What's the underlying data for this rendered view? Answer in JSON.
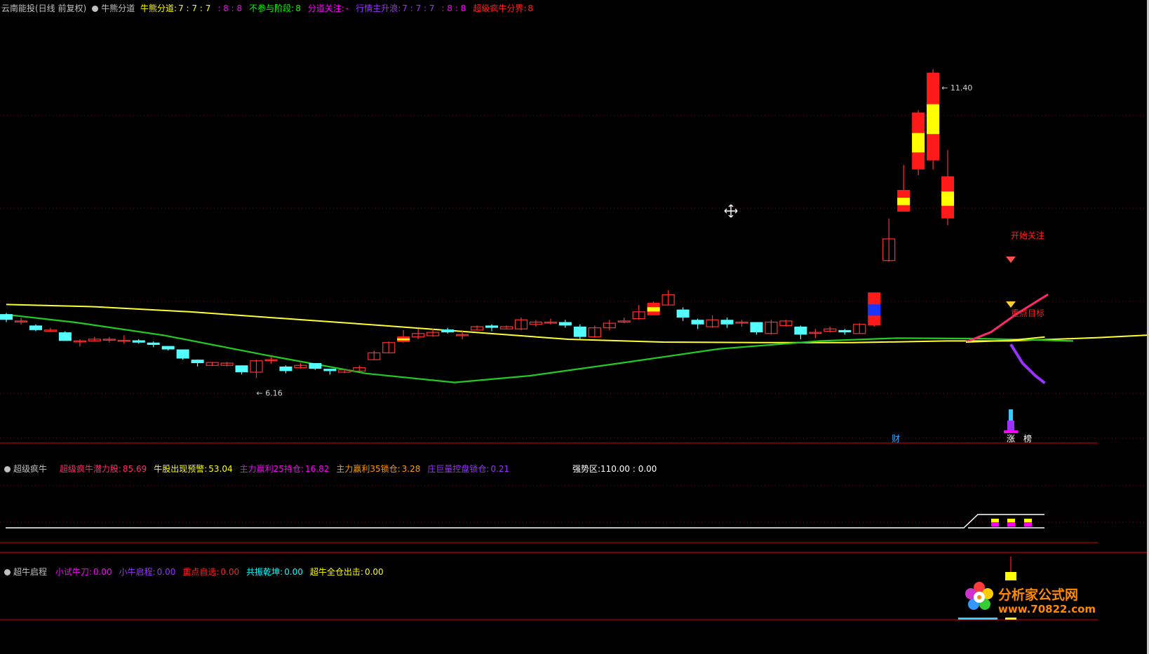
{
  "main_header": {
    "stock": "云南能投(日线 前复权)",
    "indicator": "牛熊分道",
    "items": [
      {
        "label": "牛熊分道:",
        "value": "7 : 7 : 7",
        "extra": ": 8 : 8",
        "color": "#ffff00",
        "vcolor": "#ffff00",
        "xcolor": "#ff00ff"
      },
      {
        "label": "不参与阶段:",
        "value": "8",
        "color": "#00ff00",
        "vcolor": "#00ff00"
      },
      {
        "label": "分道关注:",
        "value": "-",
        "color": "#ff00ff",
        "vcolor": "#ff00ff"
      },
      {
        "label": "行情主升浪:",
        "value": "7 : 7 : 7",
        "extra": ": 8 : 8",
        "color": "#9933ff",
        "vcolor": "#9933ff",
        "xcolor": "#ff00ff"
      },
      {
        "label": "超级疯牛分界:",
        "value": "8",
        "color": "#ff2020",
        "vcolor": "#ff2020"
      }
    ]
  },
  "sub1_header": {
    "indicator": "超级疯牛",
    "items": [
      {
        "label": "超级疯牛潜力股:",
        "value": "85.69",
        "color": "#ff2a6a"
      },
      {
        "label": "牛股出现预警:",
        "value": "53.04",
        "color": "#ffff00"
      },
      {
        "label": "主力赢利25持仓:",
        "value": "16.82",
        "color": "#ff00ff"
      },
      {
        "label": "主力赢利35锁仓:",
        "value": "3.28",
        "color": "#ff9900"
      },
      {
        "label": "庄巨量控盘锁仓:",
        "value": "0.21",
        "color": "#9933ff"
      }
    ],
    "zone_label": "强势区:",
    "zone_value": "110.00 : 0.00"
  },
  "sub2_header": {
    "indicator": "超牛启程",
    "items": [
      {
        "label": "小试牛刀:",
        "value": "0.00",
        "color": "#ff00ff"
      },
      {
        "label": "小牛启程:",
        "value": "0.00",
        "color": "#9933ff"
      },
      {
        "label": "重点自选:",
        "value": "0.00",
        "color": "#ff2020"
      },
      {
        "label": "共振乾坤:",
        "value": "0.00",
        "color": "#00ffff"
      },
      {
        "label": "超牛全仓出击:",
        "value": "0.00",
        "color": "#ffff00"
      }
    ]
  },
  "annotations": {
    "high": "11.40",
    "low": "6.16",
    "start_watch": "开始关注",
    "key_target": "重点目标",
    "cai": "财",
    "zhang": "涨",
    "bang": "榜"
  },
  "logo": {
    "brand": "分析家公式网",
    "url": "www.70822.com"
  },
  "chart_data": {
    "type": "candlestick",
    "ylim": [
      5.6,
      12.0
    ],
    "low_marker": 6.16,
    "high_marker": 11.4,
    "candles": [
      [
        7.42,
        7.32,
        7.44,
        7.28
      ],
      [
        7.3,
        7.3,
        7.36,
        7.24
      ],
      [
        7.22,
        7.14,
        7.24,
        7.12
      ],
      [
        7.12,
        7.14,
        7.18,
        7.1
      ],
      [
        7.1,
        6.95,
        7.12,
        6.95
      ],
      [
        6.95,
        6.95,
        6.98,
        6.85
      ],
      [
        6.95,
        6.98,
        7.02,
        6.94
      ],
      [
        6.98,
        6.98,
        7.02,
        6.92
      ],
      [
        6.96,
        6.96,
        7.05,
        6.9
      ],
      [
        6.96,
        6.92,
        6.98,
        6.9
      ],
      [
        6.92,
        6.88,
        6.94,
        6.84
      ],
      [
        6.86,
        6.8,
        6.86,
        6.78
      ],
      [
        6.8,
        6.64,
        6.8,
        6.62
      ],
      [
        6.62,
        6.56,
        6.62,
        6.5
      ],
      [
        6.52,
        6.57,
        6.58,
        6.51
      ],
      [
        6.52,
        6.56,
        6.58,
        6.5
      ],
      [
        6.52,
        6.4,
        6.52,
        6.36
      ],
      [
        6.4,
        6.6,
        6.62,
        6.3
      ],
      [
        6.62,
        6.62,
        6.68,
        6.55
      ],
      [
        6.5,
        6.42,
        6.52,
        6.38
      ],
      [
        6.48,
        6.52,
        6.56,
        6.46
      ],
      [
        6.56,
        6.46,
        6.56,
        6.44
      ],
      [
        6.46,
        6.42,
        6.46,
        6.36
      ],
      [
        6.4,
        6.44,
        6.46,
        6.38
      ],
      [
        6.42,
        6.48,
        6.52,
        6.42
      ],
      [
        6.62,
        6.74,
        6.78,
        6.62
      ],
      [
        6.74,
        6.92,
        6.94,
        6.74
      ],
      [
        6.93,
        7.03,
        7.14,
        6.92
      ],
      [
        7.02,
        7.08,
        7.16,
        6.98
      ],
      [
        7.04,
        7.1,
        7.16,
        7.02
      ],
      [
        7.15,
        7.1,
        7.18,
        7.08
      ],
      [
        7.06,
        7.06,
        7.14,
        6.98
      ],
      [
        7.14,
        7.2,
        7.22,
        7.14
      ],
      [
        7.22,
        7.18,
        7.24,
        7.12
      ],
      [
        7.16,
        7.2,
        7.22,
        7.16
      ],
      [
        7.16,
        7.32,
        7.36,
        7.14
      ],
      [
        7.24,
        7.28,
        7.32,
        7.2
      ],
      [
        7.28,
        7.28,
        7.34,
        7.24
      ],
      [
        7.28,
        7.22,
        7.32,
        7.18
      ],
      [
        7.2,
        7.02,
        7.24,
        6.98
      ],
      [
        7.02,
        7.18,
        7.22,
        7.0
      ],
      [
        7.18,
        7.26,
        7.32,
        7.14
      ],
      [
        7.28,
        7.3,
        7.36,
        7.26
      ],
      [
        7.34,
        7.46,
        7.58,
        7.32
      ],
      [
        7.4,
        7.62,
        7.64,
        7.4
      ],
      [
        7.58,
        7.76,
        7.84,
        7.58
      ],
      [
        7.5,
        7.36,
        7.54,
        7.3
      ],
      [
        7.32,
        7.24,
        7.34,
        7.16
      ],
      [
        7.2,
        7.32,
        7.4,
        7.18
      ],
      [
        7.32,
        7.24,
        7.36,
        7.18
      ],
      [
        7.28,
        7.28,
        7.32,
        7.2
      ],
      [
        7.28,
        7.1,
        7.28,
        7.06
      ],
      [
        7.08,
        7.28,
        7.32,
        7.06
      ],
      [
        7.22,
        7.3,
        7.32,
        7.2
      ],
      [
        7.2,
        7.06,
        7.22,
        6.98
      ],
      [
        7.1,
        7.1,
        7.16,
        7.0
      ],
      [
        7.12,
        7.16,
        7.2,
        7.1
      ],
      [
        7.14,
        7.1,
        7.16,
        7.06
      ],
      [
        7.08,
        7.24,
        7.26,
        7.08
      ],
      [
        7.22,
        7.8,
        7.8,
        7.2
      ],
      [
        8.36,
        8.74,
        9.1,
        8.34
      ],
      [
        9.22,
        9.6,
        10.04,
        9.22
      ],
      [
        9.96,
        10.96,
        11.0,
        9.86
      ],
      [
        10.12,
        11.66,
        11.72,
        9.96
      ],
      [
        9.1,
        9.84,
        10.3,
        8.98
      ]
    ],
    "yellow_types": [
      null,
      null,
      null,
      null,
      null,
      null,
      null,
      null,
      null,
      null,
      null,
      null,
      null,
      null,
      null,
      null,
      null,
      null,
      null,
      null,
      null,
      null,
      null,
      null,
      null,
      null,
      null,
      "bar",
      null,
      null,
      null,
      null,
      null,
      null,
      null,
      null,
      null,
      null,
      null,
      null,
      null,
      null,
      null,
      null,
      "bar",
      null,
      null,
      null,
      null,
      null,
      null,
      null,
      null,
      null,
      null,
      null,
      null,
      null,
      null,
      "blue",
      null,
      "bar",
      "bar",
      "bar",
      "bar",
      null
    ]
  }
}
